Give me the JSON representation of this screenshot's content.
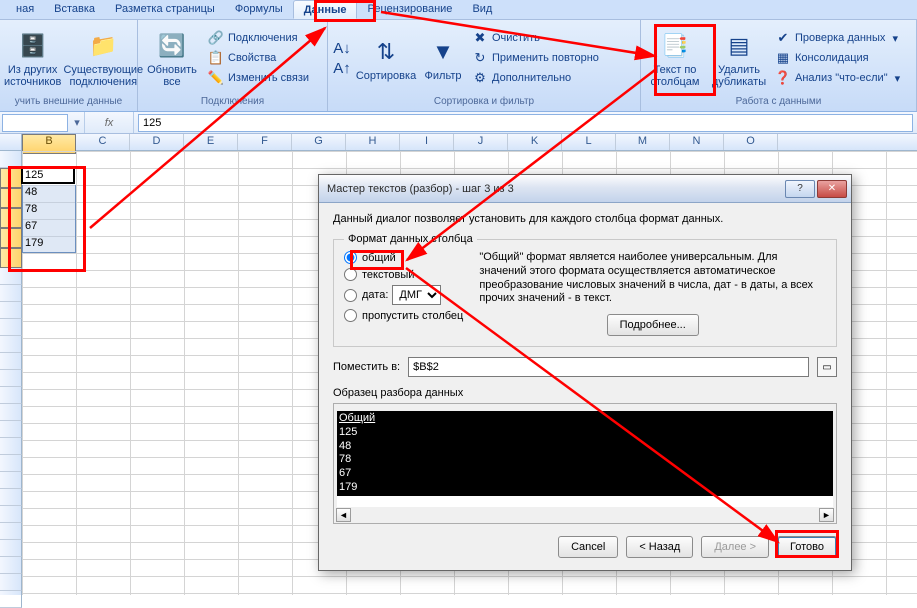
{
  "tabs": {
    "t1": "ная",
    "t2": "Вставка",
    "t3": "Разметка страницы",
    "t4": "Формулы",
    "t5": "Данные",
    "t6": "Рецензирование",
    "t7": "Вид"
  },
  "ribbon": {
    "group1": {
      "label": "учить внешние данные",
      "btn1": "Из других источников",
      "btn2": "Существующие подключения"
    },
    "group2": {
      "label": "Подключения",
      "refresh": "Обновить все",
      "conn": "Подключения",
      "props": "Свойства",
      "links": "Изменить связи"
    },
    "group3": {
      "label": "Сортировка и фильтр",
      "sort": "Сортировка",
      "filter": "Фильтр",
      "clear": "Очистить",
      "reapply": "Применить повторно",
      "advanced": "Дополнительно"
    },
    "group4": {
      "label": "Работа с данными",
      "ttc": "Текст по столбцам",
      "dedup": "Удалить дубликаты",
      "dv": "Проверка данных",
      "consol": "Консолидация",
      "whatif": "Анализ \"что-если\""
    }
  },
  "formula": {
    "namebox": "",
    "fx": "fx",
    "value": "125"
  },
  "columns": [
    "B",
    "C",
    "D",
    "E",
    "F",
    "G",
    "H",
    "I",
    "J",
    "K",
    "L",
    "M",
    "N",
    "O"
  ],
  "cells": {
    "r1": "125",
    "r2": "48",
    "r3": "78",
    "r4": "67",
    "r5": "179"
  },
  "dialog": {
    "title": "Мастер текстов (разбор) - шаг 3 из 3",
    "intro": "Данный диалог позволяет установить для каждого столбца формат данных.",
    "fieldset": "Формат данных столбца",
    "opt_general": "общий",
    "opt_text": "текстовый",
    "opt_date": "дата:",
    "date_fmt": "ДМГ",
    "opt_skip": "пропустить столбец",
    "desc": "\"Общий\" формат является наиболее универсальным. Для значений этого формата осуществляется автоматическое преобразование числовых значений в числа, дат - в даты, а всех прочих значений - в текст.",
    "more": "Подробнее...",
    "dest_label": "Поместить в:",
    "dest_value": "$B$2",
    "preview_label": "Образец разбора данных",
    "preview_header": "Общий",
    "preview_rows": [
      "125",
      "48",
      "78",
      "67",
      "179"
    ],
    "cancel": "Cancel",
    "back": "< Назад",
    "next": "Далее >",
    "finish": "Готово"
  }
}
